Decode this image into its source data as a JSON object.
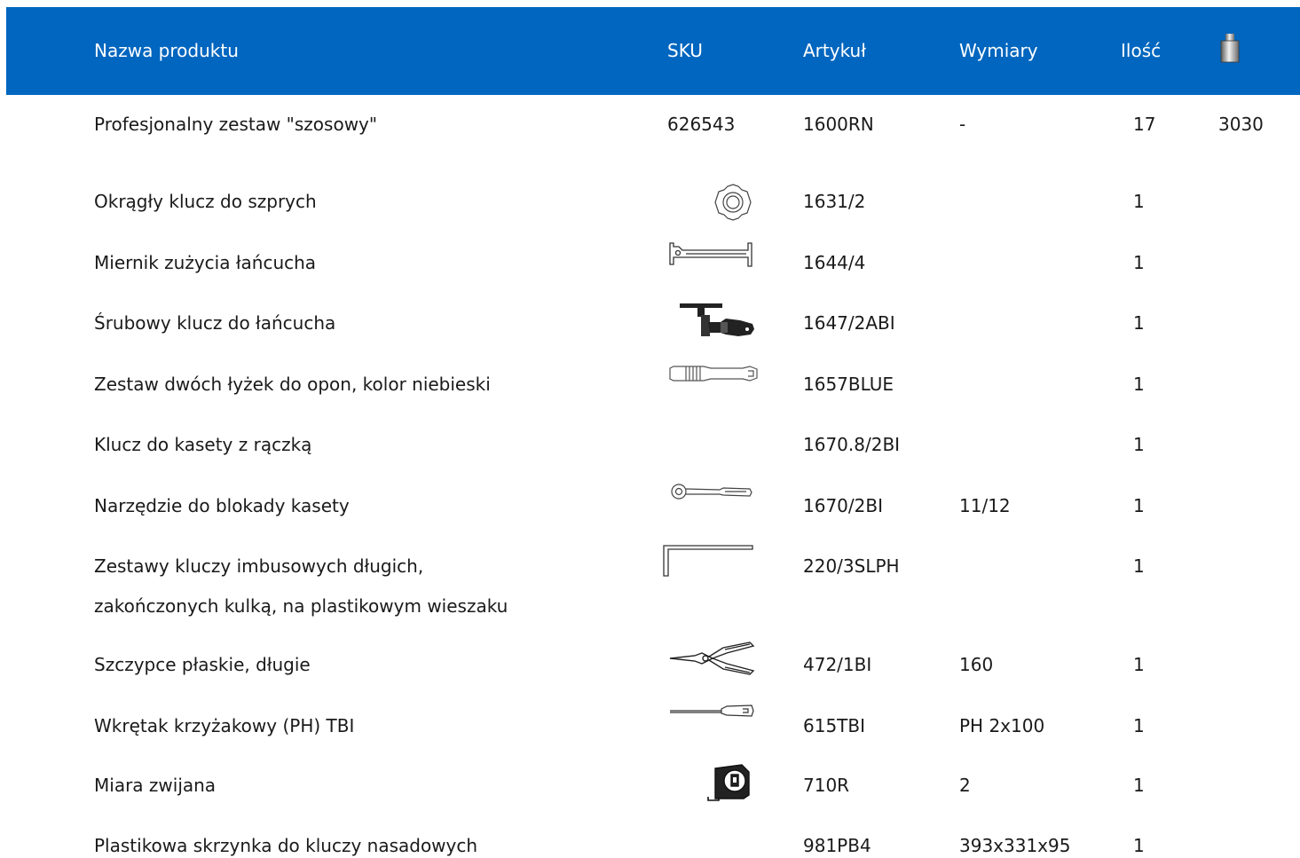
{
  "header": {
    "col_name": "Nazwa produktu",
    "col_sku": "SKU",
    "col_article": "Artykuł",
    "col_dimensions": "Wymiary",
    "col_quantity": "Ilość",
    "weight_icon": "weight-icon",
    "background": "#0066bf"
  },
  "rows": [
    {
      "name": "Profesjonalny zestaw \"szosowy\"",
      "sku": "626543",
      "article": "1600RN",
      "dimensions": "-",
      "quantity": "17",
      "weight": "3030"
    },
    {
      "name": "Okrągły klucz do szprych",
      "icon": "spoke-wrench-icon",
      "article": "1631/2",
      "quantity": "1"
    },
    {
      "name": "Miernik zużycia łańcucha",
      "icon": "chain-gauge-icon",
      "article": "1644/4",
      "quantity": "1"
    },
    {
      "name": "Śrubowy klucz do łańcucha",
      "icon": "chain-tool-icon",
      "article": "1647/2ABI",
      "quantity": "1"
    },
    {
      "name": "Zestaw dwóch łyżek do opon, kolor niebieski",
      "icon": "tyre-lever-icon",
      "article": "1657BLUE",
      "quantity": "1"
    },
    {
      "name": "Klucz do kasety z rączką",
      "article": "1670.8/2BI",
      "quantity": "1"
    },
    {
      "name": "Narzędzie do blokady kasety",
      "icon": "cassette-tool-icon",
      "article": "1670/2BI",
      "dimensions": "11/12",
      "quantity": "1"
    },
    {
      "name_line1": "Zestawy kluczy imbusowych długich,",
      "name_line2": "zakończonych kulką, na plastikowym wieszaku",
      "icon": "hex-key-icon",
      "article": "220/3SLPH",
      "quantity": "1"
    },
    {
      "name": "Szczypce płaskie, długie",
      "icon": "pliers-icon",
      "article": "472/1BI",
      "dimensions": "160",
      "quantity": "1"
    },
    {
      "name": "Wkrętak krzyżakowy (PH) TBI",
      "icon": "screwdriver-icon",
      "article": "615TBI",
      "dimensions": "PH 2x100",
      "quantity": "1"
    },
    {
      "name": "Miara zwijana",
      "icon": "tape-measure-icon",
      "article": "710R",
      "dimensions": "2",
      "quantity": "1"
    },
    {
      "name": "Plastikowa skrzynka do kluczy nasadowych",
      "article": "981PB4",
      "dimensions": "393x331x95",
      "quantity": "1"
    }
  ]
}
